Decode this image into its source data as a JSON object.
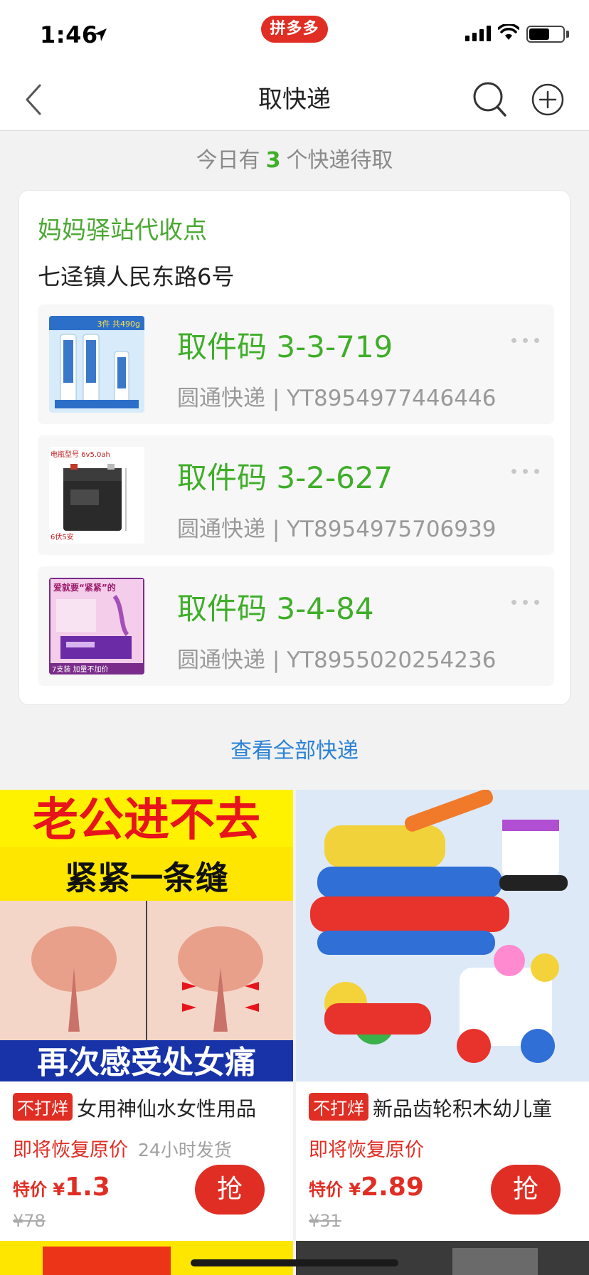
{
  "status_bar": {
    "time": "1:46",
    "brand": "拼多多"
  },
  "nav": {
    "title": "取快递"
  },
  "summary": {
    "prefix": "今日有",
    "count": "3",
    "suffix": "个快递待取"
  },
  "station": {
    "name": "妈妈驿站代收点",
    "address": "七迳镇人民东路6号",
    "parcels": [
      {
        "code": "取件码 3-3-719",
        "carrier": "圆通快递",
        "tracking": "YT8954977446446",
        "thumb": "toothpaste-product-thumb",
        "thumb_caption": "3件 共490g"
      },
      {
        "code": "取件码 3-2-627",
        "carrier": "圆通快递",
        "tracking": "YT8954975706939",
        "thumb": "battery-product-thumb",
        "thumb_caption": "电瓶型号 6v5.0ah",
        "thumb_footer": "6伏5安"
      },
      {
        "code": "取件码 3-4-84",
        "carrier": "圆通快递",
        "tracking": "YT8955020254236",
        "thumb": "care-product-thumb",
        "thumb_caption": "爱就要“紧紧”的",
        "thumb_footer": "7支装 加量不加价"
      }
    ]
  },
  "view_all": "查看全部快递",
  "products": [
    {
      "tag": "不打烊",
      "title": "女用神仙水女性用品",
      "restore": "即将恢复原价",
      "ship": "24小时发货",
      "price_label": "特价 ¥",
      "price": "1.3",
      "original": "¥78",
      "grab": "抢",
      "img_top": "老公进不去",
      "img_mid": "紧紧一条缝",
      "img_bottom": "再次感受处女痛"
    },
    {
      "tag": "不打烊",
      "title": "新品齿轮积木幼儿童",
      "restore": "即将恢复原价",
      "ship": "",
      "price_label": "特价 ¥",
      "price": "2.89",
      "original": "¥31",
      "grab": "抢"
    }
  ],
  "colors": {
    "brand_red": "#e02e24",
    "green": "#3fae29",
    "link_blue": "#2b82d6"
  }
}
